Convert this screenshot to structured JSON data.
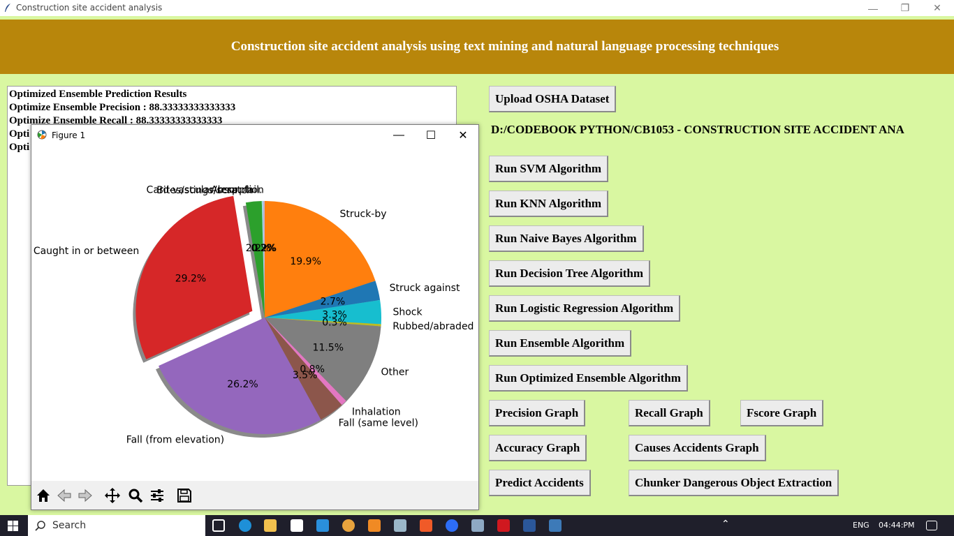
{
  "window": {
    "title": "Construction site accident analysis"
  },
  "header": {
    "title": "Construction site accident analysis using text mining and natural language processing techniques"
  },
  "output": {
    "lines": [
      "Optimized Ensemble Prediction Results",
      "Optimize Ensemble Precision : 88.33333333333333",
      "Optimize Ensemble Recall : 88.33333333333333",
      "Opti",
      "Opti"
    ]
  },
  "controls": {
    "upload": "Upload OSHA Dataset",
    "path": "D:/CODEBOOK PYTHON/CB1053 - CONSTRUCTION SITE ACCIDENT ANA",
    "svm": "Run SVM Algorithm",
    "knn": "Run KNN Algorithm",
    "naive_bayes": "Run Naive Bayes Algorithm",
    "decision_tree": "Run Decision Tree Algorithm",
    "logistic": "Run Logistic Regression Algorithm",
    "ensemble": "Run Ensemble Algorithm",
    "optimized_ensemble": "Run Optimized Ensemble Algorithm",
    "precision_graph": "Precision Graph",
    "recall_graph": "Recall Graph",
    "fscore_graph": "Fscore Graph",
    "accuracy_graph": "Accuracy Graph",
    "causes_graph": "Causes Accidents Graph",
    "predict": "Predict Accidents",
    "chunker": "Chunker Dangerous Object Extraction"
  },
  "figure": {
    "title": "Figure 1"
  },
  "chart_data": {
    "type": "pie",
    "slices": [
      {
        "label": "Struck-by",
        "pct_label": "19.9%",
        "value": 19.9,
        "color": "#ff7f0e"
      },
      {
        "label": "Struck against",
        "pct_label": "2.7%",
        "value": 2.7,
        "color": "#1f77b4"
      },
      {
        "label": "Shock",
        "pct_label": "3.3%",
        "value": 3.3,
        "color": "#17becf"
      },
      {
        "label": "Rubbed/abraded",
        "pct_label": "0.3%",
        "value": 0.3,
        "color": "#bcbd22"
      },
      {
        "label": "Other",
        "pct_label": "11.5%",
        "value": 11.5,
        "color": "#7f7f7f"
      },
      {
        "label": "Inhalation",
        "pct_label": "0.8%",
        "value": 0.8,
        "color": "#e377c2"
      },
      {
        "label": "Fall (same level)",
        "pct_label": "3.5%",
        "value": 3.5,
        "color": "#8c564b"
      },
      {
        "label": "Fall (from elevation)",
        "pct_label": "26.2%",
        "value": 26.2,
        "color": "#9467bd"
      },
      {
        "label": "Caught in or between",
        "pct_label": "29.2%",
        "value": 29.2,
        "color": "#d62728",
        "explode": true
      },
      {
        "label": "Bites/stings/scratch",
        "pct_label": "2.2%",
        "value": 2.2,
        "color": "#2ca02c"
      },
      {
        "label": "Card-vascular/resp. fail.",
        "pct_label": "0.2%",
        "value": 0.2,
        "color": "#9edae5"
      },
      {
        "label": "Absorption",
        "pct_label": "0.2%",
        "value": 0.2,
        "color": "#c5b0d5"
      }
    ],
    "start_angle_deg": 90,
    "shadow": true
  },
  "taskbar": {
    "search_label": "Search",
    "lang": "ENG",
    "time": "04:44:PM"
  }
}
